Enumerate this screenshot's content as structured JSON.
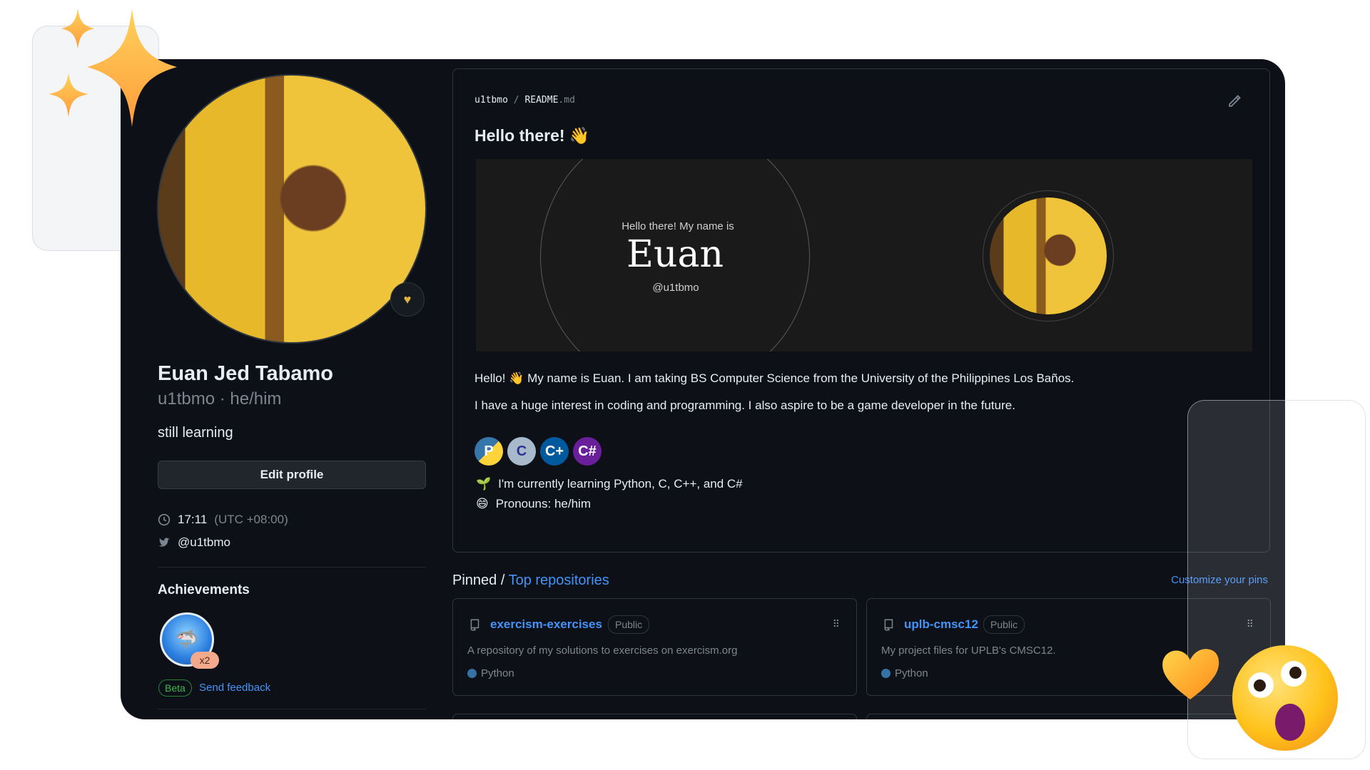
{
  "profile": {
    "full_name": "Euan Jed Tabamo",
    "username": "u1tbmo",
    "pronouns_sep": " · ",
    "pronouns": "he/him",
    "bio": "still learning",
    "edit_label": "Edit profile",
    "time": "17:11",
    "timezone": "(UTC +08:00)",
    "twitter": "@u1tbmo",
    "status_icon": "heart-icon"
  },
  "achievements": {
    "title": "Achievements",
    "badge_count": "x2",
    "beta_label": "Beta",
    "feedback_label": "Send feedback"
  },
  "readme": {
    "crumb_user": "u1tbmo",
    "crumb_sep": "/",
    "crumb_file": "README",
    "crumb_ext": ".md",
    "greeting": "Hello there!",
    "greeting_emoji": "👋",
    "banner_intro": "Hello there! My name is",
    "banner_name": "Euan",
    "banner_handle": "@u1tbmo",
    "paragraph1": "Hello! 👋 My name is Euan. I am taking BS Computer Science from the University of the Philippines Los Baños.",
    "paragraph2": "I have a huge interest in coding and programming. I also aspire to be a game developer in the future.",
    "tech_icons": [
      "python-icon",
      "c-icon",
      "cpp-icon",
      "csharp-icon"
    ],
    "bullet1_emoji": "🌱",
    "bullet1": "I'm currently learning Python, C, C++, and C#",
    "bullet2_emoji": "😄",
    "bullet2": "Pronouns: he/him"
  },
  "pinned": {
    "label": "Pinned",
    "sep": " / ",
    "link": "Top repositories",
    "customize": "Customize your pins",
    "repos": [
      {
        "name": "exercism-exercises",
        "visibility": "Public",
        "description": "A repository of my solutions to exercises on exercism.org",
        "language": "Python",
        "lang_color": "#3572A5"
      },
      {
        "name": "uplb-cmsc12",
        "visibility": "Public",
        "description": "My project files for UPLB's CMSC12.",
        "language": "Python",
        "lang_color": "#3572A5"
      }
    ]
  },
  "colors": {
    "background": "#0d1117",
    "text": "#e6edf3",
    "muted": "#7d8590",
    "link": "#4493f8",
    "border": "#30363d"
  }
}
